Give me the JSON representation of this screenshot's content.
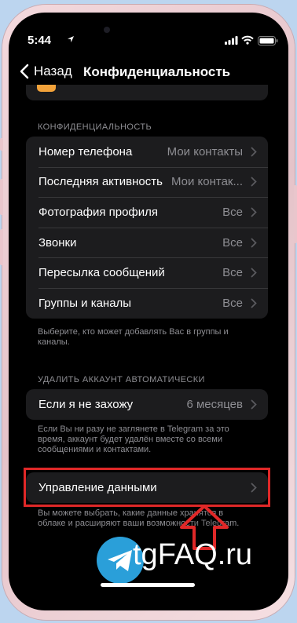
{
  "status_bar": {
    "time": "5:44"
  },
  "nav": {
    "back_label": "Назад",
    "title": "Конфиденциальность"
  },
  "privacy_section": {
    "header": "КОНФИДЕНЦИАЛЬНОСТЬ",
    "rows": [
      {
        "label": "Номер телефона",
        "value": "Мои контакты"
      },
      {
        "label": "Последняя активность",
        "value": "Мои контак..."
      },
      {
        "label": "Фотография профиля",
        "value": "Все"
      },
      {
        "label": "Звонки",
        "value": "Все"
      },
      {
        "label": "Пересылка сообщений",
        "value": "Все"
      },
      {
        "label": "Группы и каналы",
        "value": "Все"
      }
    ],
    "footer": "Выберите, кто может добавлять Вас в группы и каналы."
  },
  "delete_section": {
    "header": "УДАЛИТЬ АККАУНТ АВТОМАТИЧЕСКИ",
    "row": {
      "label": "Если я не захожу",
      "value": "6 месяцев"
    },
    "footer": "Если Вы ни разу не заглянете в Telegram за это время, аккаунт будет удалён вместе со всеми сообщениями и контактами."
  },
  "data_section": {
    "row": {
      "label": "Управление данными"
    },
    "footer": "Вы можете выбрать, какие данные хранятся в облаке и расширяют ваши возможности Telegram."
  },
  "watermark": {
    "text": "tgFAQ.ru"
  },
  "colors": {
    "background": "#000000",
    "cell": "#1c1c1e",
    "secondary_text": "#8e8e93",
    "highlight": "#e02828",
    "logo": "#2a9fd9"
  }
}
